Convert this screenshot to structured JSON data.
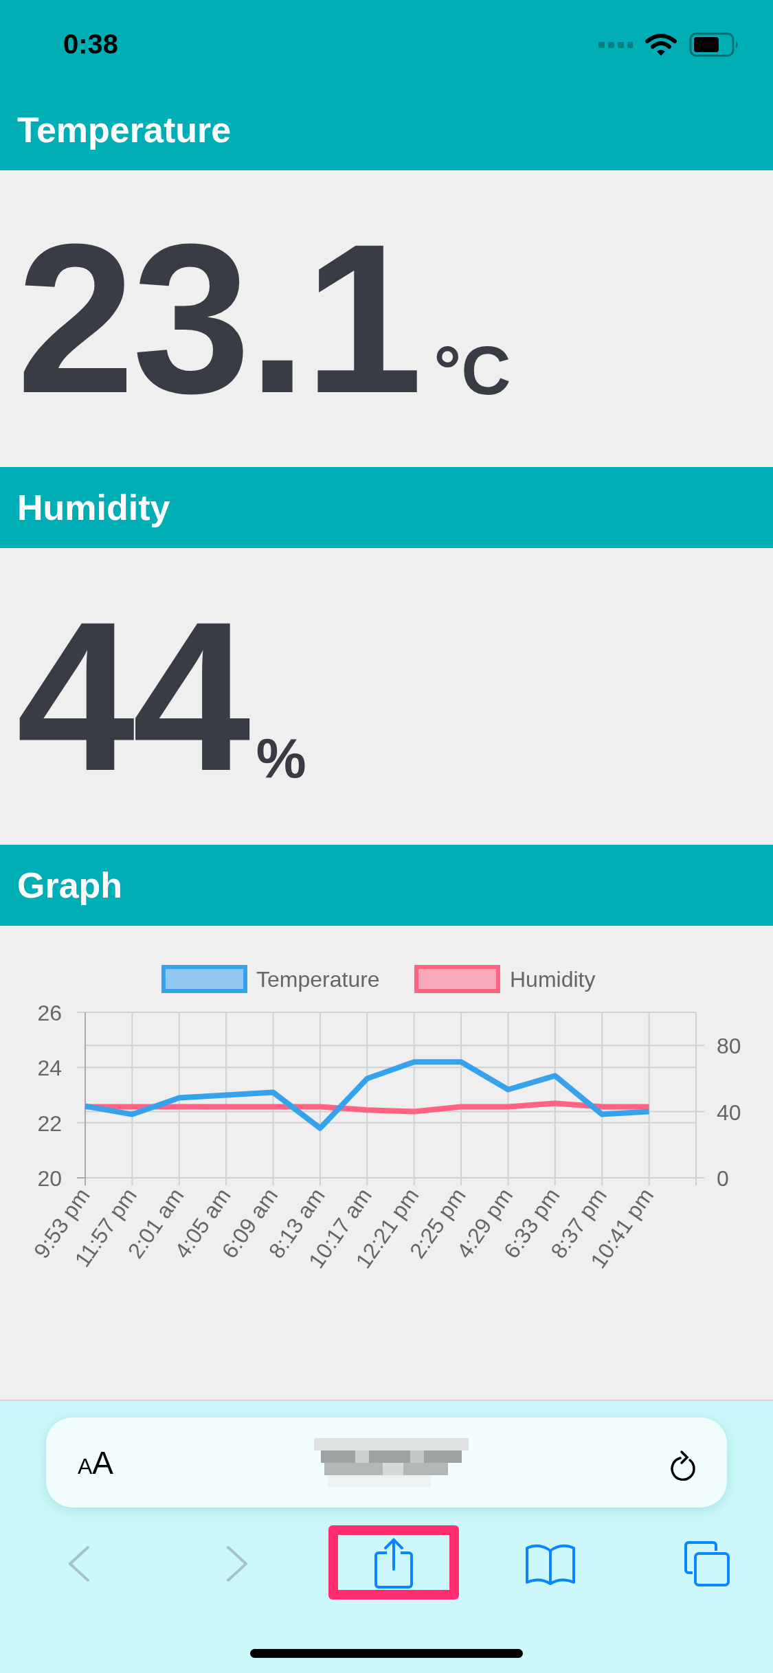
{
  "status_bar": {
    "time": "0:38"
  },
  "sections": [
    {
      "kind": "reading",
      "title": "Temperature",
      "value": "23.1",
      "unit": "°C"
    },
    {
      "kind": "reading",
      "title": "Humidity",
      "value": "44",
      "unit": "%"
    },
    {
      "kind": "chart",
      "title": "Graph",
      "chart_data": {
        "type": "line",
        "legend": "top",
        "grid": true,
        "categories": [
          "9:53 pm",
          "11:57 pm",
          "2:01 am",
          "4:05 am",
          "6:09 am",
          "8:13 am",
          "10:17 am",
          "12:21 pm",
          "2:25 pm",
          "4:29 pm",
          "6:33 pm",
          "8:37 pm",
          "10:41 pm"
        ],
        "ylim": [
          20,
          26
        ],
        "yticks": [
          20,
          22,
          24,
          26
        ],
        "y2lim": [
          0,
          100
        ],
        "y2ticks": [
          0,
          40,
          80
        ],
        "series": [
          {
            "name": "Temperature",
            "color": "#36a2eb",
            "values": [
              22.6,
              22.3,
              22.9,
              23.0,
              23.1,
              21.8,
              23.6,
              24.2,
              24.2,
              23.2,
              23.7,
              22.3,
              22.4
            ]
          },
          {
            "name": "Humidity",
            "color": "#ff6384",
            "axis": "y2",
            "values": [
              43,
              43,
              43,
              43,
              43,
              43,
              41,
              40,
              43,
              43,
              45,
              43,
              43
            ]
          }
        ]
      }
    }
  ],
  "browser": {
    "text_size_button": "AA",
    "toolbar": [
      {
        "kind": "back",
        "disabled": true,
        "highlighted": false
      },
      {
        "kind": "forward",
        "disabled": true,
        "highlighted": false
      },
      {
        "kind": "share",
        "disabled": false,
        "highlighted": true
      },
      {
        "kind": "bookmarks",
        "disabled": false,
        "highlighted": false
      },
      {
        "kind": "tabs",
        "disabled": false,
        "highlighted": false
      }
    ]
  }
}
